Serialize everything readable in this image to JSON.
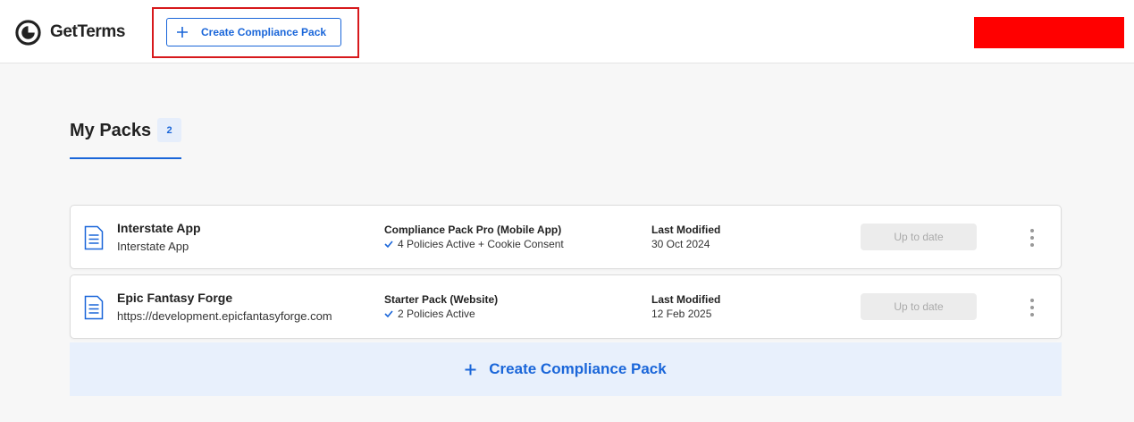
{
  "header": {
    "brand": "GetTerms",
    "create_button_label": "Create Compliance Pack"
  },
  "section": {
    "title": "My Packs",
    "count": "2"
  },
  "packs": [
    {
      "name": "Interstate App",
      "sub": "Interstate App",
      "plan": "Compliance Pack Pro (Mobile App)",
      "policies": "4 Policies Active + Cookie Consent",
      "modified_label": "Last Modified",
      "modified_date": "30 Oct 2024",
      "status": "Up to date"
    },
    {
      "name": "Epic Fantasy Forge",
      "sub": "https://development.epicfantasyforge.com",
      "plan": "Starter Pack (Website)",
      "policies": "2 Policies Active",
      "modified_label": "Last Modified",
      "modified_date": "12 Feb 2025",
      "status": "Up to date"
    }
  ],
  "footer_create_label": "Create Compliance Pack",
  "icons": {
    "logo": "getterms-logo-icon",
    "plus": "plus-icon",
    "document": "document-icon",
    "check": "check-icon",
    "menu": "more-vertical-icon"
  },
  "colors": {
    "accent": "#1a66d9",
    "highlight_border": "#d7191c",
    "redaction": "#ff0000",
    "create_banner_bg": "#e8f0fc"
  }
}
